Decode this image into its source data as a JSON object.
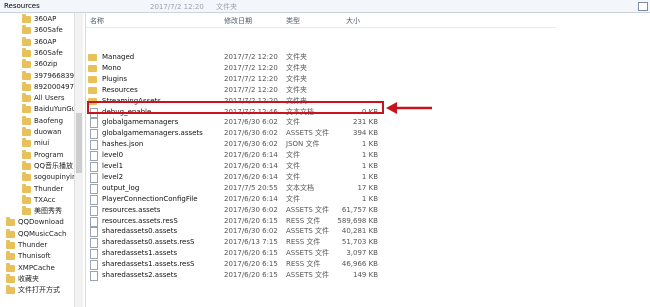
{
  "window": {
    "path_label": "Resources",
    "ghost_row": {
      "date": "2017/7/2 12:20",
      "type": "文件夹"
    }
  },
  "sidebar": {
    "items": [
      {
        "label": "360AP",
        "indent": 1
      },
      {
        "label": "360Safe",
        "indent": 1
      },
      {
        "label": "360AP",
        "indent": 1
      },
      {
        "label": "360Safe",
        "indent": 1
      },
      {
        "label": "360zip",
        "indent": 1
      },
      {
        "label": "397966839",
        "indent": 1
      },
      {
        "label": "892000497",
        "indent": 1
      },
      {
        "label": "All Users",
        "indent": 1
      },
      {
        "label": "BaiduYunGu",
        "indent": 1
      },
      {
        "label": "Baofeng",
        "indent": 1
      },
      {
        "label": "duowan",
        "indent": 1
      },
      {
        "label": "miui",
        "indent": 1
      },
      {
        "label": "Program",
        "indent": 1
      },
      {
        "label": "QQ音乐播放",
        "indent": 1
      },
      {
        "label": "sogoupinyir",
        "indent": 1
      },
      {
        "label": "Thunder",
        "indent": 1
      },
      {
        "label": "TXAcc",
        "indent": 1
      },
      {
        "label": "美图秀秀",
        "indent": 1
      },
      {
        "label": "QQDownload",
        "indent": 0
      },
      {
        "label": "QQMusicCach",
        "indent": 0
      },
      {
        "label": "Thunder",
        "indent": 0
      },
      {
        "label": "Thunisoft",
        "indent": 0
      },
      {
        "label": "XMPCache",
        "indent": 0
      },
      {
        "label": "收藏夹",
        "indent": 0
      },
      {
        "label": "文件打开方式",
        "indent": 0
      }
    ]
  },
  "columns": {
    "name": "名称",
    "date": "修改日期",
    "type": "类型",
    "size": "大小"
  },
  "files": [
    {
      "name": "Managed",
      "date": "2017/7/2 12:20",
      "type": "文件夹",
      "size": "",
      "kind": "folder"
    },
    {
      "name": "Mono",
      "date": "2017/7/2 12:20",
      "type": "文件夹",
      "size": "",
      "kind": "folder"
    },
    {
      "name": "Plugins",
      "date": "2017/7/2 12:20",
      "type": "文件夹",
      "size": "",
      "kind": "folder"
    },
    {
      "name": "Resources",
      "date": "2017/7/2 12:20",
      "type": "文件夹",
      "size": "",
      "kind": "folder"
    },
    {
      "name": "StreamingAssets",
      "date": "2017/7/2 12:20",
      "type": "文件夹",
      "size": "",
      "kind": "folder"
    },
    {
      "name": "debug_enable",
      "date": "2017/7/2 12:46",
      "type": "文本文档",
      "size": "0 KB",
      "kind": "file"
    },
    {
      "name": "globalgamemanagers",
      "date": "2017/6/30 6:02",
      "type": "文件",
      "size": "231 KB",
      "kind": "file"
    },
    {
      "name": "globalgamemanagers.assets",
      "date": "2017/6/30 6:02",
      "type": "ASSETS 文件",
      "size": "394 KB",
      "kind": "file"
    },
    {
      "name": "hashes.json",
      "date": "2017/6/30 6:02",
      "type": "JSON 文件",
      "size": "1 KB",
      "kind": "file"
    },
    {
      "name": "level0",
      "date": "2017/6/20 6:14",
      "type": "文件",
      "size": "1 KB",
      "kind": "file"
    },
    {
      "name": "level1",
      "date": "2017/6/20 6:14",
      "type": "文件",
      "size": "1 KB",
      "kind": "file"
    },
    {
      "name": "level2",
      "date": "2017/6/20 6:14",
      "type": "文件",
      "size": "1 KB",
      "kind": "file"
    },
    {
      "name": "output_log",
      "date": "2017/7/5 20:55",
      "type": "文本文档",
      "size": "17 KB",
      "kind": "file"
    },
    {
      "name": "PlayerConnectionConfigFile",
      "date": "2017/6/20 6:14",
      "type": "文件",
      "size": "1 KB",
      "kind": "file"
    },
    {
      "name": "resources.assets",
      "date": "2017/6/30 6:02",
      "type": "ASSETS 文件",
      "size": "61,757 KB",
      "kind": "file"
    },
    {
      "name": "resources.assets.resS",
      "date": "2017/6/20 6:15",
      "type": "RESS 文件",
      "size": "589,698 KB",
      "kind": "file"
    },
    {
      "name": "sharedassets0.assets",
      "date": "2017/6/30 6:02",
      "type": "ASSETS 文件",
      "size": "40,281 KB",
      "kind": "file"
    },
    {
      "name": "sharedassets0.assets.resS",
      "date": "2017/6/13 7:15",
      "type": "RESS 文件",
      "size": "51,703 KB",
      "kind": "file"
    },
    {
      "name": "sharedassets1.assets",
      "date": "2017/6/20 6:15",
      "type": "ASSETS 文件",
      "size": "3,097 KB",
      "kind": "file"
    },
    {
      "name": "sharedassets1.assets.resS",
      "date": "2017/6/20 6:15",
      "type": "RESS 文件",
      "size": "46,966 KB",
      "kind": "file"
    },
    {
      "name": "sharedassets2.assets",
      "date": "2017/6/20 6:15",
      "type": "ASSETS 文件",
      "size": "149 KB",
      "kind": "file"
    }
  ],
  "highlight": {
    "row_name": "debug_enable",
    "color": "#c8141c"
  }
}
